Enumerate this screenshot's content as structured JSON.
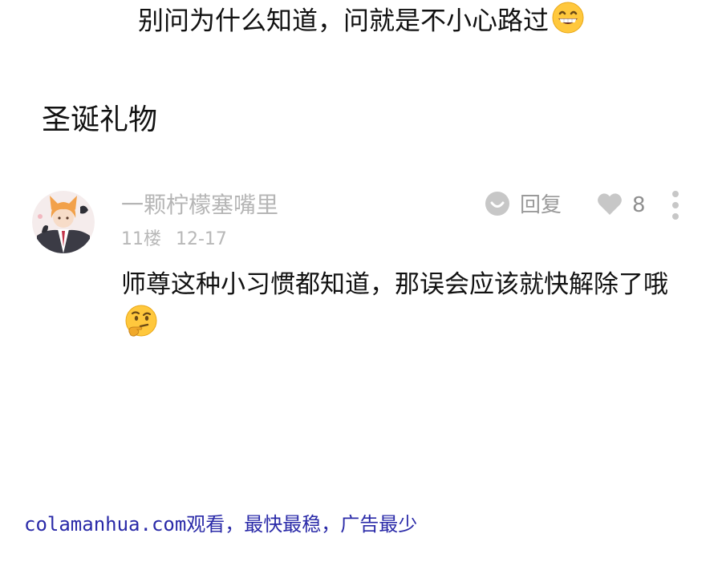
{
  "page": {
    "top_line": "别问为什么知道，问就是不小心路过",
    "top_emoji": "grinning-face-emoji",
    "section_title": "圣诞礼物"
  },
  "comment": {
    "username": "一颗柠檬塞嘴里",
    "reply_label": "回复",
    "like_count": "8",
    "floor": "11楼",
    "date": "12-17",
    "body": "师尊这种小习惯都知道，那误会应该就快解除了哦",
    "body_emoji": "thinking-face-emoji",
    "icons": {
      "reply": "reply-bubble-icon",
      "like": "heart-icon",
      "more": "more-vertical-icon"
    }
  },
  "watermark": "colamanhua.com观看，最快最稳，广告最少",
  "colors": {
    "muted_text": "#b5b5b5",
    "icon_gray": "#c7c7c7",
    "watermark": "#2a2aa8",
    "emoji_yellow": "#ffc83d"
  }
}
